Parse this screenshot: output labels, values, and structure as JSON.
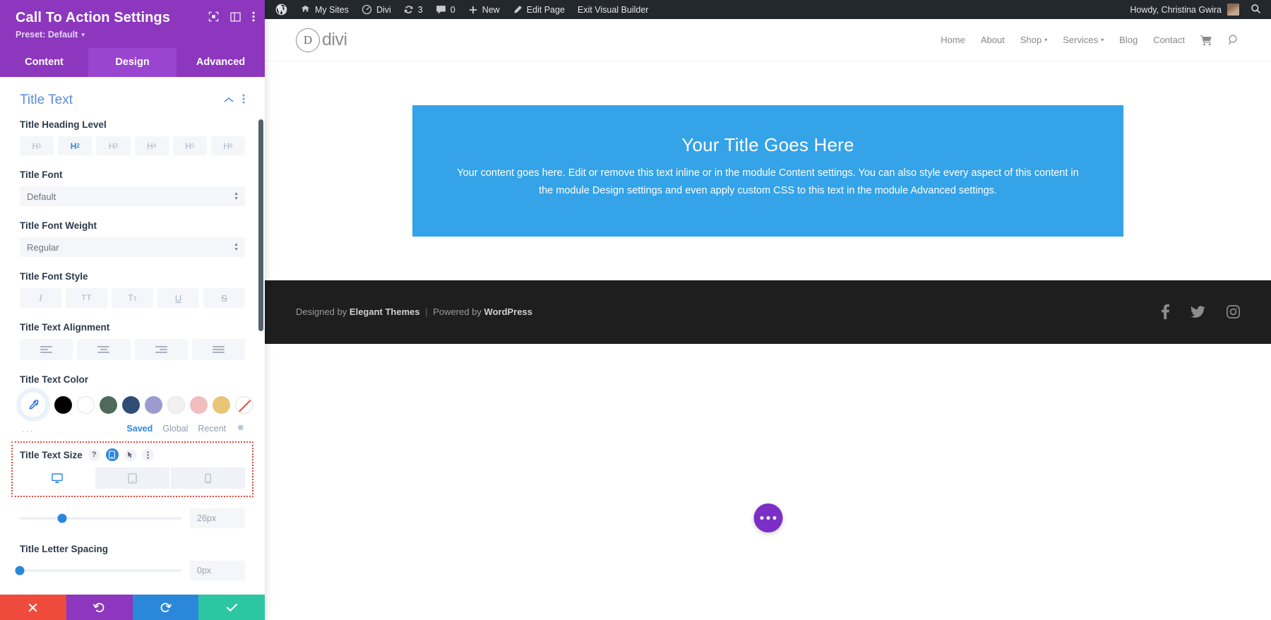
{
  "settings_panel": {
    "title": "Call To Action Settings",
    "preset_label": "Preset: Default",
    "header_icons": [
      {
        "name": "focus-icon"
      },
      {
        "name": "layout-columns-icon"
      },
      {
        "name": "kebab-menu-icon"
      }
    ],
    "tabs": [
      {
        "label": "Content",
        "active": false
      },
      {
        "label": "Design",
        "active": true
      },
      {
        "label": "Advanced",
        "active": false
      }
    ],
    "section": {
      "title": "Title Text",
      "collapse_icon": "chevron-up-icon",
      "menu_icon": "kebab-menu-icon"
    },
    "fields": {
      "heading_level": {
        "label": "Title Heading Level",
        "options": [
          "H1",
          "H2",
          "H3",
          "H4",
          "H5",
          "H6"
        ],
        "active_index": 1
      },
      "font": {
        "label": "Title Font",
        "value": "Default"
      },
      "font_weight": {
        "label": "Title Font Weight",
        "value": "Regular"
      },
      "font_style": {
        "label": "Title Font Style",
        "options": [
          "italic",
          "uppercase",
          "capitalize",
          "underline",
          "strikethrough"
        ]
      },
      "text_alignment": {
        "label": "Title Text Alignment",
        "options": [
          "left",
          "center",
          "right",
          "justify"
        ]
      },
      "text_color": {
        "label": "Title Text Color",
        "eyedropper": "eyedropper-icon",
        "swatches": [
          "#000000",
          "#FFFFFF",
          "#4F6A5C",
          "#2F4C74",
          "#9B9BD0",
          "#F2F0F0",
          "#F0BEBE",
          "#E8C577"
        ],
        "none_swatch": "transparent",
        "more_label": "...",
        "palette_tabs": [
          {
            "label": "Saved",
            "active": true
          },
          {
            "label": "Global",
            "active": false
          },
          {
            "label": "Recent",
            "active": false
          }
        ],
        "settings_icon": "gear-icon"
      },
      "text_size": {
        "label": "Title Text Size",
        "help_icon": "question-mark-icon",
        "responsive_icon": "responsive-device-icon",
        "hover_icon": "cursor-pointer-icon",
        "menu_icon": "kebab-menu-icon",
        "devices": [
          {
            "name": "desktop",
            "active": true
          },
          {
            "name": "tablet",
            "active": false
          },
          {
            "name": "phone",
            "active": false
          }
        ],
        "value": "26px",
        "slider_percent": 26,
        "highlighted": true
      },
      "letter_spacing": {
        "label": "Title Letter Spacing",
        "value": "0px",
        "slider_percent": 0
      }
    },
    "actions": [
      {
        "name": "cancel",
        "icon": "close-icon",
        "color": "#EE4B3D"
      },
      {
        "name": "undo",
        "icon": "undo-icon",
        "color": "#8C37BE"
      },
      {
        "name": "redo",
        "icon": "redo-icon",
        "color": "#2B87DA"
      },
      {
        "name": "save",
        "icon": "check-icon",
        "color": "#2CC6A3"
      }
    ]
  },
  "admin_bar": {
    "items": [
      {
        "label": "",
        "icon": "wordpress-logo-icon"
      },
      {
        "label": "My Sites",
        "icon": "sites-icon"
      },
      {
        "label": "Divi",
        "icon": "divi-icon"
      },
      {
        "label": "3",
        "icon": "updates-icon"
      },
      {
        "label": "0",
        "icon": "comments-icon"
      },
      {
        "label": "New",
        "icon": "plus-icon"
      },
      {
        "label": "Edit Page",
        "icon": "pencil-icon"
      },
      {
        "label": "Exit Visual Builder",
        "icon": ""
      }
    ],
    "howdy": "Howdy, Christina Gwira",
    "avatar": "user-avatar",
    "search_icon": "search-icon"
  },
  "site": {
    "logo": {
      "mark": "D",
      "text": "divi"
    },
    "nav": [
      {
        "label": "Home",
        "has_dropdown": false
      },
      {
        "label": "About",
        "has_dropdown": false
      },
      {
        "label": "Shop",
        "has_dropdown": true
      },
      {
        "label": "Services",
        "has_dropdown": true
      },
      {
        "label": "Blog",
        "has_dropdown": false
      },
      {
        "label": "Contact",
        "has_dropdown": false
      }
    ],
    "cart_icon": "shopping-cart-icon",
    "search_icon": "search-icon",
    "cta": {
      "title": "Your Title Goes Here",
      "body": "Your content goes here. Edit or remove this text inline or in the module Content settings. You can also style every aspect of this content in the module Design settings and even apply custom CSS to this text in the module Advanced settings.",
      "bg_color": "#34A3E8"
    },
    "footer": {
      "prefix": "Designed by",
      "brand": "Elegant Themes",
      "separator": "|",
      "middle": "Powered by",
      "platform": "WordPress",
      "socials": [
        {
          "name": "facebook-icon"
        },
        {
          "name": "twitter-icon"
        },
        {
          "name": "instagram-icon"
        }
      ]
    },
    "fab": {
      "name": "divi-menu-fab",
      "color": "#7B2FC6"
    }
  }
}
